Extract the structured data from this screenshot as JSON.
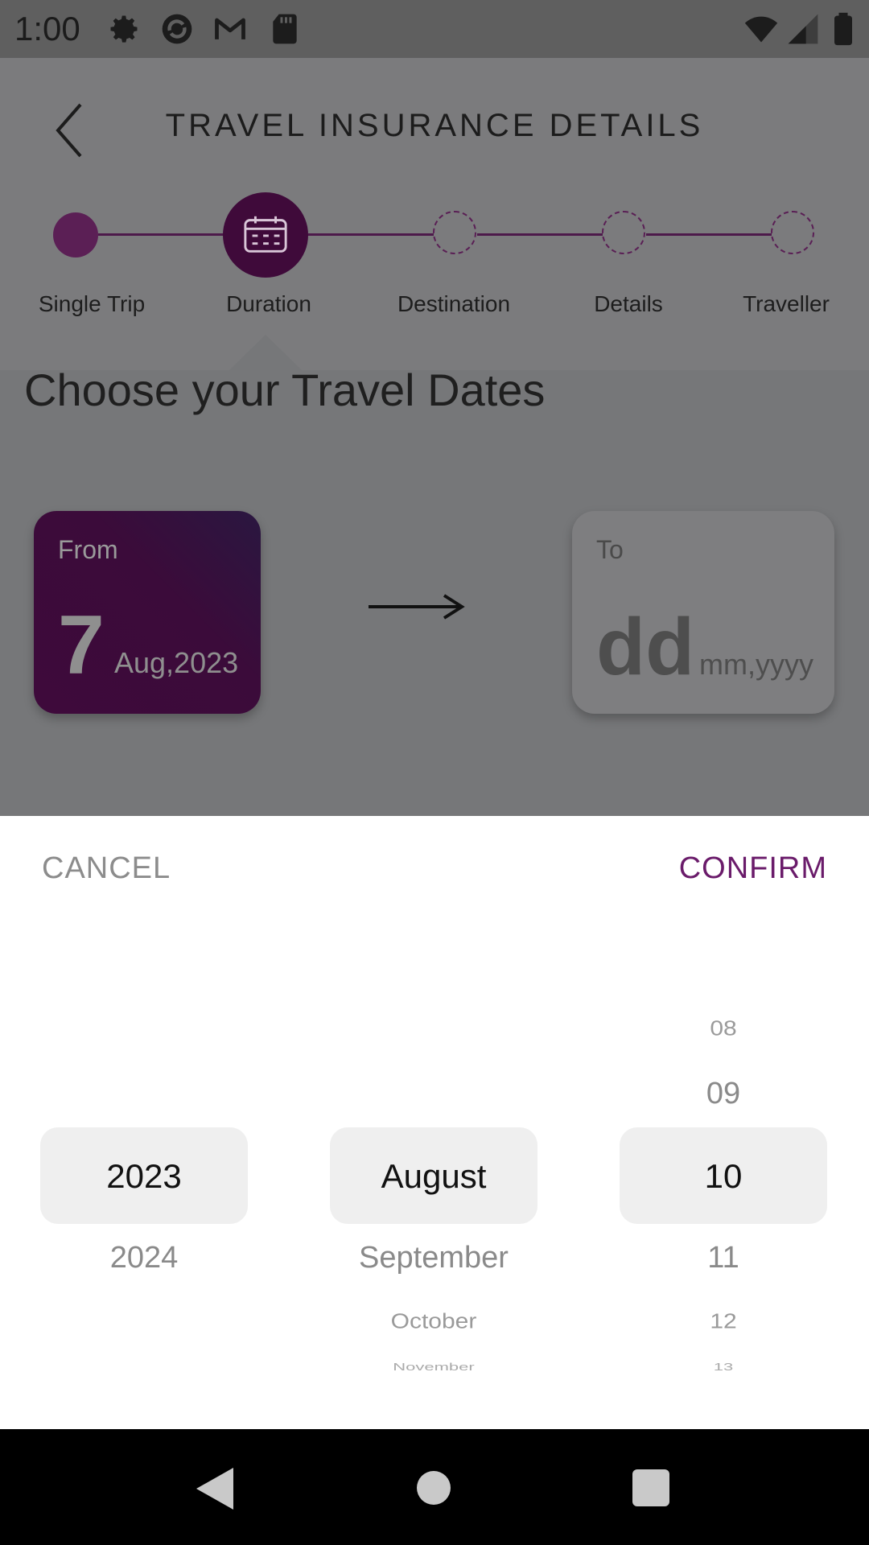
{
  "status_bar": {
    "time": "1:00",
    "icons_left": [
      "gear-icon",
      "sync-icon",
      "gmail-icon",
      "sd-card-icon"
    ],
    "icons_right": [
      "wifi-icon",
      "signal-icon",
      "battery-icon"
    ]
  },
  "header": {
    "title": "TRAVEL INSURANCE DETAILS"
  },
  "stepper": {
    "steps": [
      {
        "label": "Single Trip",
        "state": "done"
      },
      {
        "label": "Duration",
        "state": "active"
      },
      {
        "label": "Destination",
        "state": "todo"
      },
      {
        "label": "Details",
        "state": "todo"
      },
      {
        "label": "Traveller",
        "state": "todo"
      }
    ]
  },
  "main": {
    "title": "Choose your Travel Dates",
    "from": {
      "label": "From",
      "day": "7",
      "month_year": "Aug,2023"
    },
    "to": {
      "label": "To",
      "day": "dd",
      "month_year": "mm,yyyy"
    }
  },
  "picker": {
    "cancel_label": "CANCEL",
    "confirm_label": "CONFIRM",
    "year": {
      "selected": "2023",
      "next": [
        "2024"
      ]
    },
    "month": {
      "selected": "August",
      "next": [
        "September",
        "October",
        "November"
      ]
    },
    "day": {
      "prev": [
        "08",
        "09"
      ],
      "selected": "10",
      "next": [
        "11",
        "12",
        "13"
      ]
    }
  },
  "colors": {
    "accent": "#6a1b6a",
    "card_from": "#3e0a3b",
    "overlay_bg": "#767779"
  }
}
